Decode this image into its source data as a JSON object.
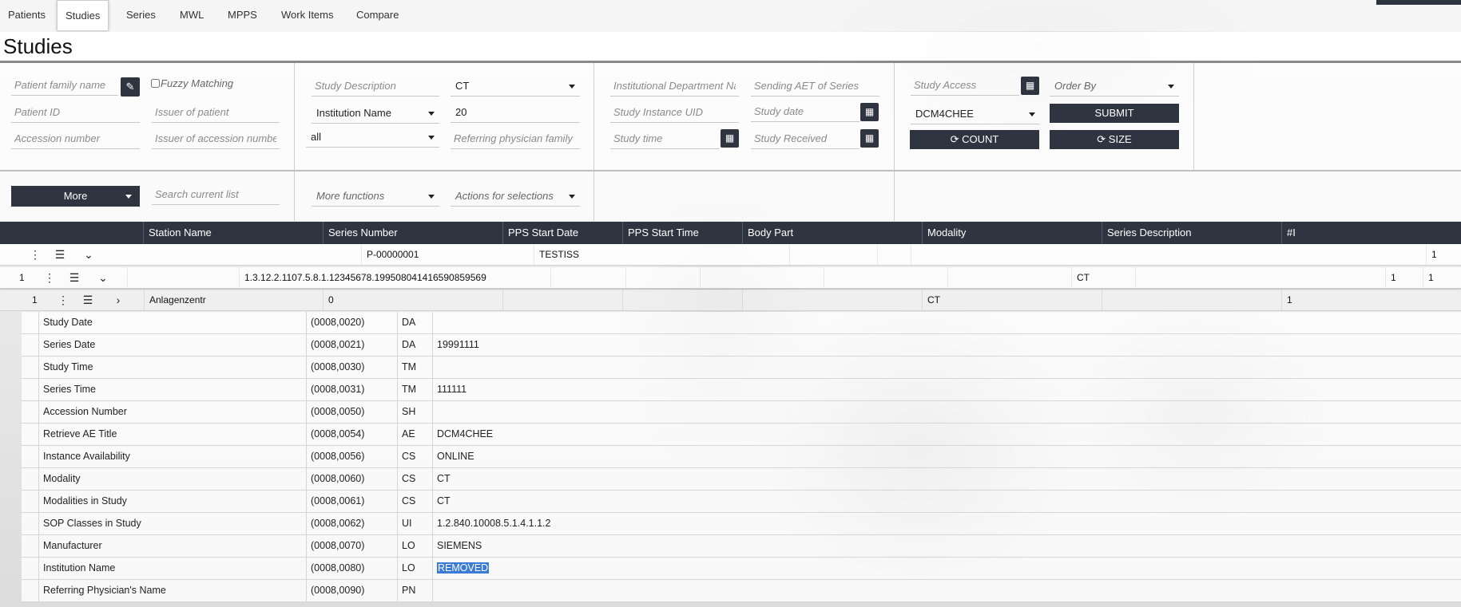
{
  "nav": {
    "tabs": [
      "Patients",
      "Studies",
      "Series",
      "MWL",
      "MPPS",
      "Work Items",
      "Compare"
    ],
    "active": "Studies"
  },
  "page_title": "Studies",
  "filters": {
    "patient_family_name": "Patient family name",
    "fuzzy_matching": "Fuzzy Matching",
    "patient_id": "Patient ID",
    "issuer_of_patient": "Issuer of patient",
    "accession_number": "Accession number",
    "issuer_of_accession": "Issuer of accession numbe",
    "study_description": "Study Description",
    "modality_value": "CT",
    "institution_name_select": "Institution Name",
    "limit_value": "20",
    "all_value": "all",
    "referring_physician": "Referring physician family",
    "institutional_department": "Institutional Department Na",
    "sending_aet": "Sending AET of Series",
    "study_instance_uid": "Study Instance UID",
    "study_date": "Study date",
    "study_time": "Study time",
    "study_received": "Study Received",
    "study_access": "Study Access",
    "order_by": "Order By",
    "aet_value": "DCM4CHEE",
    "submit": "SUBMIT",
    "count": "COUNT",
    "size": "SIZE",
    "more": "More",
    "search_current_list": "Search current list",
    "more_functions": "More functions",
    "actions_for_selections": "Actions for selections"
  },
  "table": {
    "headers": [
      "Station Name",
      "Series Number",
      "PPS Start Date",
      "PPS Start Time",
      "Body Part",
      "Modality",
      "Series Description",
      "#I"
    ],
    "patient_row": {
      "patient_id": "P-00000001",
      "patient_name": "TESTISS",
      "count": "1"
    },
    "study_row": {
      "index": "1",
      "uid": "1.3.12.2.1107.5.8.1.12345678.199508041416590859569",
      "modality": "CT",
      "c1": "1",
      "c2": "1"
    },
    "series_row": {
      "index": "1",
      "station": "Anlagenzentr",
      "series_number": "0",
      "modality": "CT",
      "instances": "1"
    }
  },
  "attributes": [
    {
      "name": "Study Date",
      "tag": "(0008,0020)",
      "vr": "DA",
      "value": ""
    },
    {
      "name": "Series Date",
      "tag": "(0008,0021)",
      "vr": "DA",
      "value": "19991111"
    },
    {
      "name": "Study Time",
      "tag": "(0008,0030)",
      "vr": "TM",
      "value": ""
    },
    {
      "name": "Series Time",
      "tag": "(0008,0031)",
      "vr": "TM",
      "value": "111111"
    },
    {
      "name": "Accession Number",
      "tag": "(0008,0050)",
      "vr": "SH",
      "value": ""
    },
    {
      "name": "Retrieve AE Title",
      "tag": "(0008,0054)",
      "vr": "AE",
      "value": "DCM4CHEE"
    },
    {
      "name": "Instance Availability",
      "tag": "(0008,0056)",
      "vr": "CS",
      "value": "ONLINE"
    },
    {
      "name": "Modality",
      "tag": "(0008,0060)",
      "vr": "CS",
      "value": "CT"
    },
    {
      "name": "Modalities in Study",
      "tag": "(0008,0061)",
      "vr": "CS",
      "value": "CT"
    },
    {
      "name": "SOP Classes in Study",
      "tag": "(0008,0062)",
      "vr": "UI",
      "value": "1.2.840.10008.5.1.4.1.1.2"
    },
    {
      "name": "Manufacturer",
      "tag": "(0008,0070)",
      "vr": "LO",
      "value": "SIEMENS"
    },
    {
      "name": "Institution Name",
      "tag": "(0008,0080)",
      "vr": "LO",
      "value": "REMOVED",
      "selected": true
    },
    {
      "name": "Referring Physician's Name",
      "tag": "(0008,0090)",
      "vr": "PN",
      "value": ""
    }
  ],
  "colors": {
    "dark": "#2e3440",
    "selection": "#3a7bd5"
  }
}
